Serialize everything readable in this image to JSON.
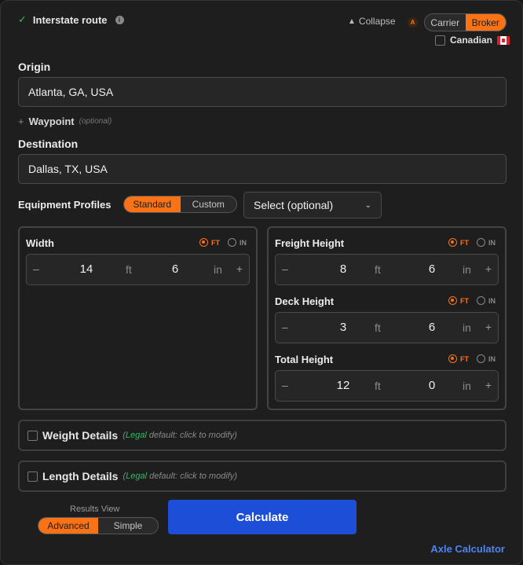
{
  "header": {
    "interstate_label": "Interstate route",
    "info_glyph": "i",
    "collapse_label": "Collapse",
    "badge_label": "A",
    "role_toggle": {
      "carrier": "Carrier",
      "broker": "Broker",
      "selected": "Broker"
    },
    "canadian_label": "Canadian",
    "canadian_checked": false
  },
  "origin": {
    "label": "Origin",
    "value": "Atlanta, GA, USA"
  },
  "waypoint": {
    "plus": "+",
    "label": "Waypoint",
    "optional": "(optional)"
  },
  "destination": {
    "label": "Destination",
    "value": "Dallas, TX, USA"
  },
  "equipment": {
    "label": "Equipment Profiles",
    "standard": "Standard",
    "custom": "Custom",
    "selected": "Standard",
    "select_value": "Select (optional)"
  },
  "units": {
    "ft": "FT",
    "in": "IN",
    "selected": "FT"
  },
  "stepper_glyphs": {
    "minus": "–",
    "plus": "+"
  },
  "dimensions": {
    "width": {
      "label": "Width",
      "ft": "14",
      "ft_unit": "ft",
      "in": "6",
      "in_unit": "in"
    },
    "freight_height": {
      "label": "Freight Height",
      "ft": "8",
      "ft_unit": "ft",
      "in": "6",
      "in_unit": "in"
    },
    "deck_height": {
      "label": "Deck Height",
      "ft": "3",
      "ft_unit": "ft",
      "in": "6",
      "in_unit": "in"
    },
    "total_height": {
      "label": "Total Height",
      "ft": "12",
      "ft_unit": "ft",
      "in": "0",
      "in_unit": "in"
    }
  },
  "weight_details": {
    "label": "Weight Details",
    "legal": "Legal",
    "hint": " default: click to modify)",
    "open_paren": "(",
    "checked": false
  },
  "length_details": {
    "label": "Length Details",
    "legal": "Legal",
    "hint": " default: click to modify)",
    "open_paren": "(",
    "checked": false
  },
  "results_view": {
    "label": "Results View",
    "advanced": "Advanced",
    "simple": "Simple",
    "selected": "Advanced"
  },
  "calculate_label": "Calculate",
  "axle_link": "Axle Calculator",
  "colors": {
    "accent": "#f97316",
    "primary": "#1d4ed8",
    "success": "#22c55e",
    "link": "#4f83f0"
  },
  "icons": {
    "check": "check-icon",
    "info": "info-icon",
    "collapse": "triangle-up-icon",
    "flag": "canada-flag-icon",
    "chevron": "chevron-down-icon"
  }
}
